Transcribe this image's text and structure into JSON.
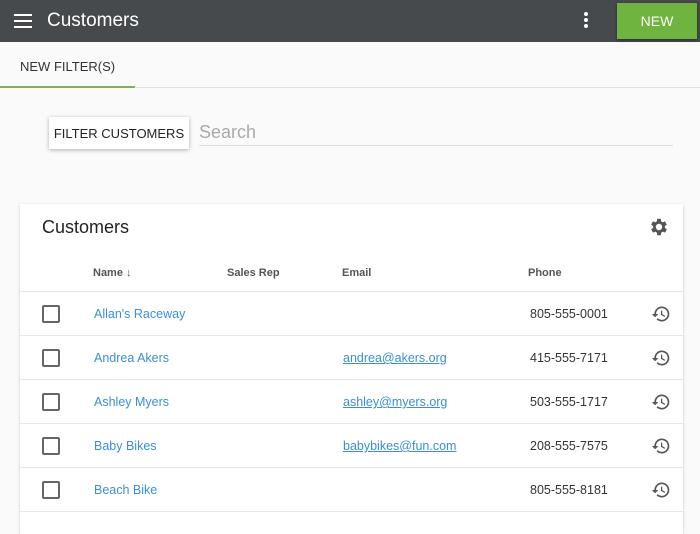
{
  "header": {
    "title": "Customers",
    "new_label": "NEW"
  },
  "tabs": [
    {
      "label": "NEW FILTER(S)"
    }
  ],
  "filter": {
    "button_label": "FILTER CUSTOMERS",
    "search_placeholder": "Search",
    "search_value": ""
  },
  "card": {
    "title": "Customers",
    "columns": [
      "Name ↓",
      "Sales Rep",
      "Email",
      "Phone"
    ]
  },
  "rows": [
    {
      "name": "Allan's Raceway",
      "sales_rep": "",
      "email": "",
      "phone": "805-555-0001"
    },
    {
      "name": "Andrea Akers",
      "sales_rep": "",
      "email": "andrea@akers.org",
      "phone": "415-555-7171"
    },
    {
      "name": "Ashley Myers",
      "sales_rep": "",
      "email": "ashley@myers.org",
      "phone": "503-555-1717"
    },
    {
      "name": "Baby Bikes",
      "sales_rep": "",
      "email": "babybikes@fun.com",
      "phone": "208-555-7575"
    },
    {
      "name": "Beach Bike",
      "sales_rep": "",
      "email": "",
      "phone": "805-555-8181"
    }
  ],
  "colors": {
    "accent": "#6eb43f",
    "link": "#3b8fd4",
    "topbar": "#464a4d"
  }
}
